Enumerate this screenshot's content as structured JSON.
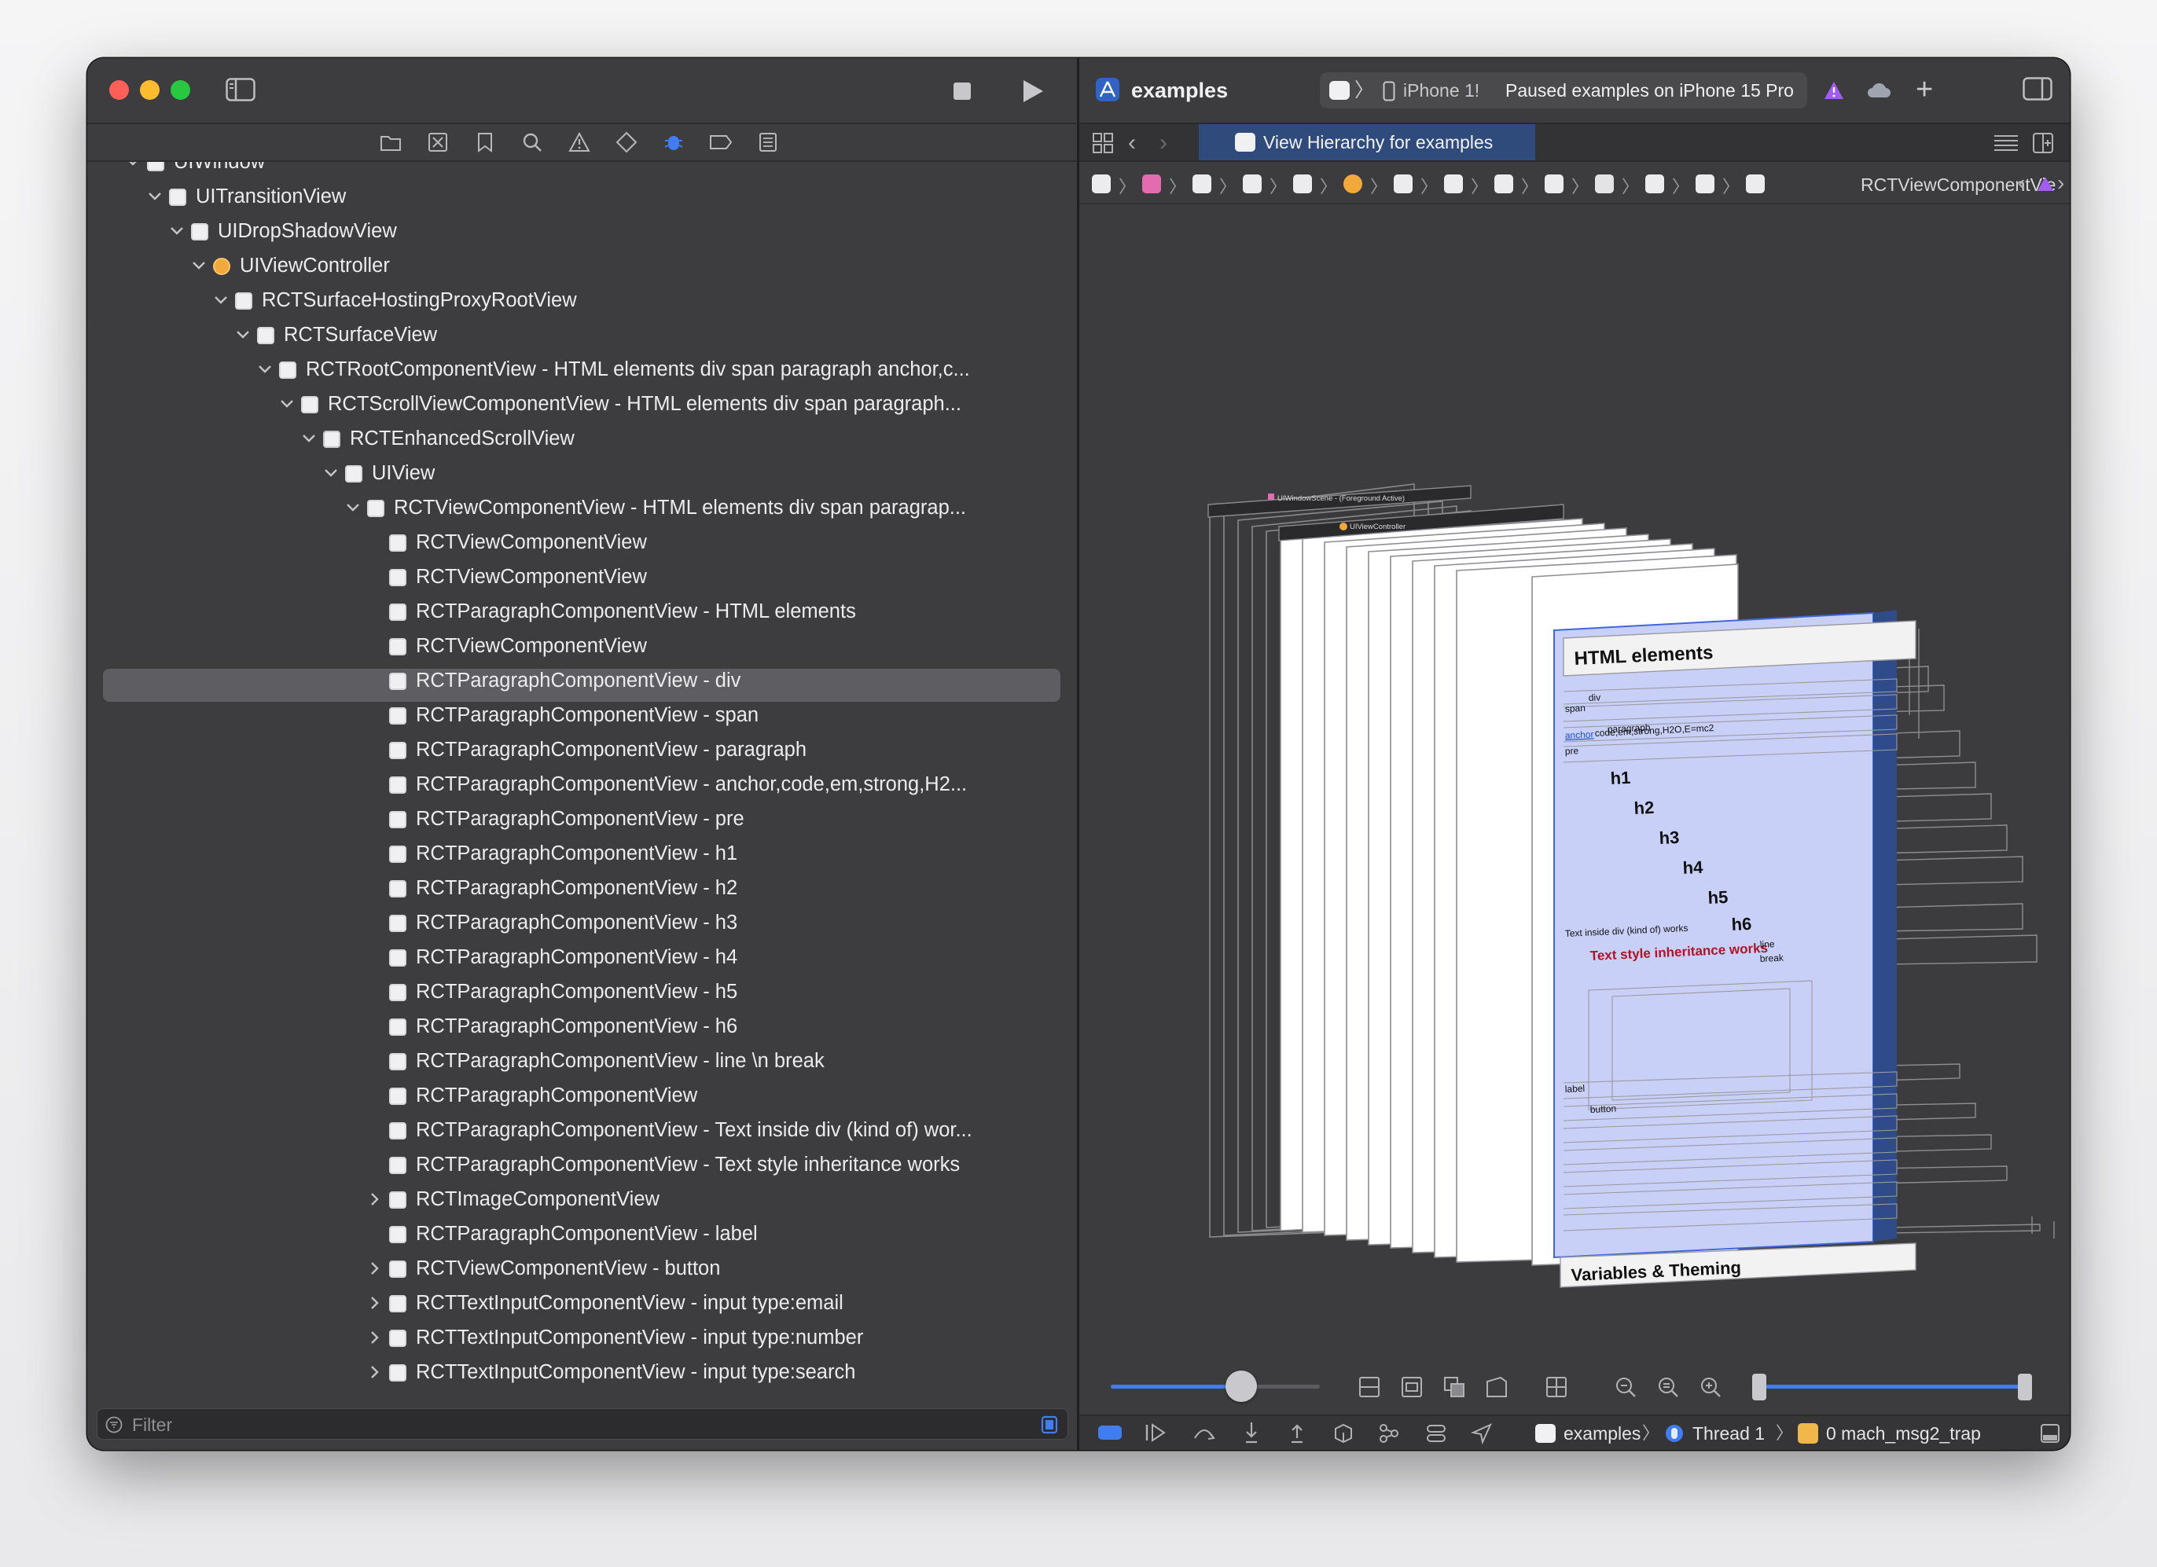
{
  "left": {
    "tree": [
      {
        "label": "UIWindow"
      },
      {
        "label": "UITransitionView"
      },
      {
        "label": "UIDropShadowView"
      },
      {
        "label": "UIViewController"
      },
      {
        "label": "RCTSurfaceHostingProxyRootView"
      },
      {
        "label": "RCTSurfaceView"
      },
      {
        "label": "RCTRootComponentView - HTML elements div span paragraph anchor,c..."
      },
      {
        "label": "RCTScrollViewComponentView - HTML elements div span paragraph..."
      },
      {
        "label": "RCTEnhancedScrollView"
      },
      {
        "label": "UIView"
      },
      {
        "label": "RCTViewComponentView - HTML elements div span paragrap..."
      },
      {
        "label": "RCTViewComponentView"
      },
      {
        "label": "RCTViewComponentView"
      },
      {
        "label": "RCTParagraphComponentView - HTML elements"
      },
      {
        "label": "RCTViewComponentView"
      },
      {
        "label": "RCTParagraphComponentView - div"
      },
      {
        "label": "RCTParagraphComponentView - span"
      },
      {
        "label": "RCTParagraphComponentView - paragraph"
      },
      {
        "label": "RCTParagraphComponentView - anchor,code,em,strong,H2..."
      },
      {
        "label": "RCTParagraphComponentView - pre"
      },
      {
        "label": "RCTParagraphComponentView - h1"
      },
      {
        "label": "RCTParagraphComponentView - h2"
      },
      {
        "label": "RCTParagraphComponentView - h3"
      },
      {
        "label": "RCTParagraphComponentView - h4"
      },
      {
        "label": "RCTParagraphComponentView - h5"
      },
      {
        "label": "RCTParagraphComponentView - h6"
      },
      {
        "label": "RCTParagraphComponentView - line \\n break"
      },
      {
        "label": "RCTParagraphComponentView"
      },
      {
        "label": "RCTParagraphComponentView - Text inside div (kind of) wor..."
      },
      {
        "label": "RCTParagraphComponentView - Text style inheritance works"
      },
      {
        "label": "RCTImageComponentView"
      },
      {
        "label": "RCTParagraphComponentView - label"
      },
      {
        "label": "RCTViewComponentView - button"
      },
      {
        "label": "RCTTextInputComponentView - input type:email"
      },
      {
        "label": "RCTTextInputComponentView - input type:number"
      },
      {
        "label": "RCTTextInputComponentView - input type:search"
      }
    ],
    "filter_placeholder": "Filter"
  },
  "right": {
    "app_name": "examples",
    "device_short": "iPhone 1!",
    "status": "Paused examples on iPhone 15 Pro",
    "tab_title": "View Hierarchy for examples",
    "breadcrumb_last": "RCTViewComponentVie",
    "canvas": {
      "scene_label": "UIWindowScene - (Foreground Active)",
      "controller_label": "UIViewController",
      "title": "HTML elements",
      "span": "span",
      "div": "div",
      "paragraph": "paragraph",
      "anchor": "anchor",
      "inline": "code,em,strong,H2O,E=mc2",
      "pre": "pre",
      "h1": "h1",
      "h2": "h2",
      "h3": "h3",
      "h4": "h4",
      "h5": "h5",
      "h6": "h6",
      "text_inside": "Text inside div (kind of) works",
      "inherit": "Text style inheritance works",
      "line": "line",
      "break": "break",
      "label": "label",
      "button": "button",
      "footer_title": "Variables & Theming"
    },
    "debug": {
      "target": "examples",
      "thread": "Thread 1",
      "frame": "0 mach_msg2_trap"
    }
  },
  "colors": {
    "accent": "#3f7df0",
    "selected_row": "#5e5e62",
    "tab_active": "#2f4b7c",
    "warning": "#a35cf0",
    "close": "#fe5f57",
    "minimize": "#febc2e",
    "zoom": "#28c840"
  }
}
